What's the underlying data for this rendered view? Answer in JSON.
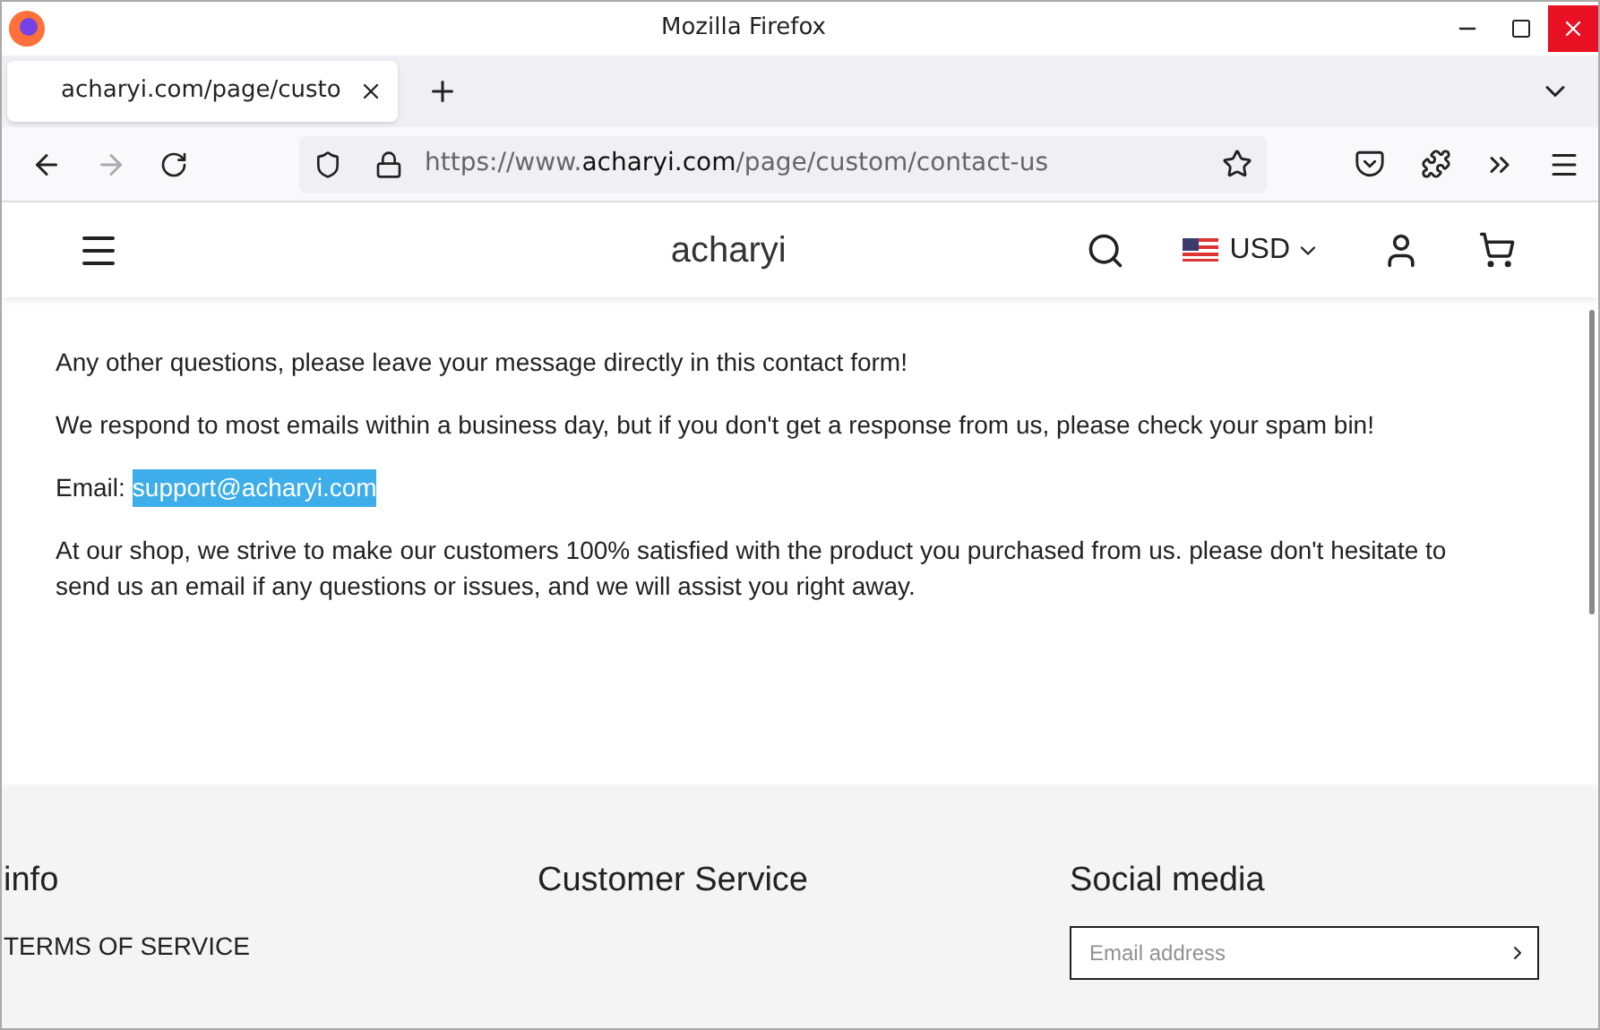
{
  "window": {
    "title": "Mozilla Firefox"
  },
  "tabs": [
    {
      "label": "acharyi.com/page/custo",
      "selected": true
    }
  ],
  "address": {
    "prefix": "https://www.",
    "domain": "acharyi.com",
    "path": "/page/custom/contact-us"
  },
  "site": {
    "logo": "acharyi",
    "currency": "USD"
  },
  "content": {
    "paragraphs": [
      "Any other questions, please leave your message directly in this contact form!",
      "We respond to most emails within a business day, but if you don't get a response from us, please check your spam bin!"
    ],
    "email_label": "Email:",
    "email": "support@acharyi.com",
    "closing": "At our shop, we strive to make our customers 100% satisfied with the product you purchased from us. please don't hesitate to send us an email if any questions or issues, and we will assist you right away."
  },
  "footer": {
    "columns": [
      {
        "title": "info",
        "links": [
          "TERMS OF SERVICE"
        ]
      },
      {
        "title": "Customer Service"
      },
      {
        "title": "Social media"
      }
    ],
    "newsletter": {
      "placeholder": "Email address"
    }
  }
}
